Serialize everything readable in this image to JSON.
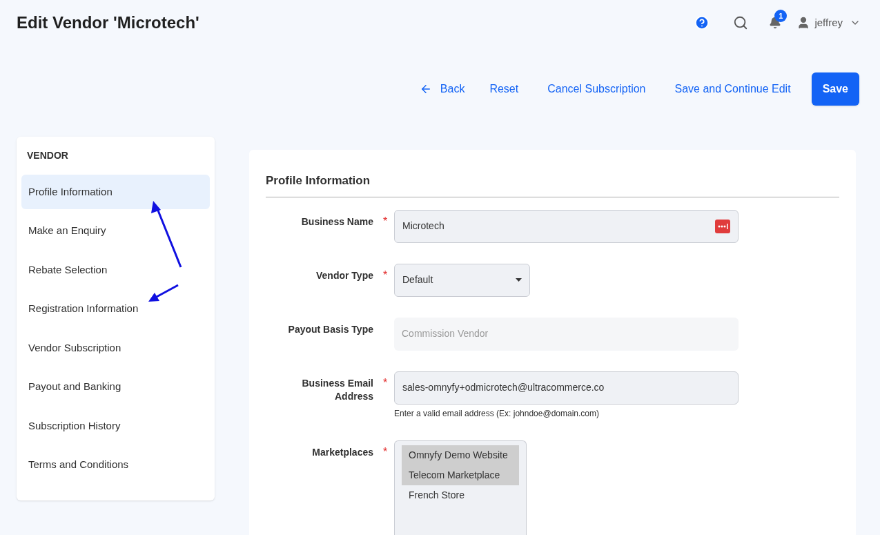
{
  "header": {
    "title": "Edit Vendor 'Microtech'",
    "notifications": "1",
    "user": "jeffrey"
  },
  "actions": [
    {
      "label": "Back",
      "kind": "back"
    },
    {
      "label": "Reset",
      "kind": "link"
    },
    {
      "label": "Cancel Subscription",
      "kind": "link"
    },
    {
      "label": "Save and Continue Edit",
      "kind": "link"
    },
    {
      "label": "Save",
      "kind": "primary"
    }
  ],
  "sidebar": {
    "heading": "VENDOR",
    "items": [
      {
        "label": "Profile Information",
        "selected": true
      },
      {
        "label": "Make an Enquiry",
        "selected": false
      },
      {
        "label": "Rebate Selection",
        "selected": false
      },
      {
        "label": "Registration Information",
        "selected": false
      },
      {
        "label": "Vendor Subscription",
        "selected": false
      },
      {
        "label": "Payout and Banking",
        "selected": false
      },
      {
        "label": "Subscription History",
        "selected": false
      },
      {
        "label": "Terms and Conditions",
        "selected": false
      }
    ]
  },
  "section": {
    "title": "Profile Information",
    "fields": [
      {
        "kind": "text",
        "label": "Business Name",
        "required_mark": "*",
        "value": "Microtech",
        "password_icon": true
      },
      {
        "kind": "select",
        "label": "Vendor Type",
        "required_mark": "*",
        "value": "Default"
      },
      {
        "kind": "disabled",
        "label": "Payout Basis Type",
        "value": "Commission Vendor"
      },
      {
        "kind": "text",
        "label": "Business Email Address",
        "required_mark": "*",
        "value": "sales-omnyfy+odmicrotech@ultracommerce.co",
        "note": "Enter a valid email address (Ex: johndoe@domain.com)"
      },
      {
        "kind": "multiselect",
        "label": "Marketplaces",
        "required_mark": "*",
        "options": [
          {
            "label": "Omnyfy Demo Website",
            "selected": true
          },
          {
            "label": "Telecom Marketplace",
            "selected": true
          },
          {
            "label": "French Store",
            "selected": false
          }
        ]
      }
    ]
  }
}
